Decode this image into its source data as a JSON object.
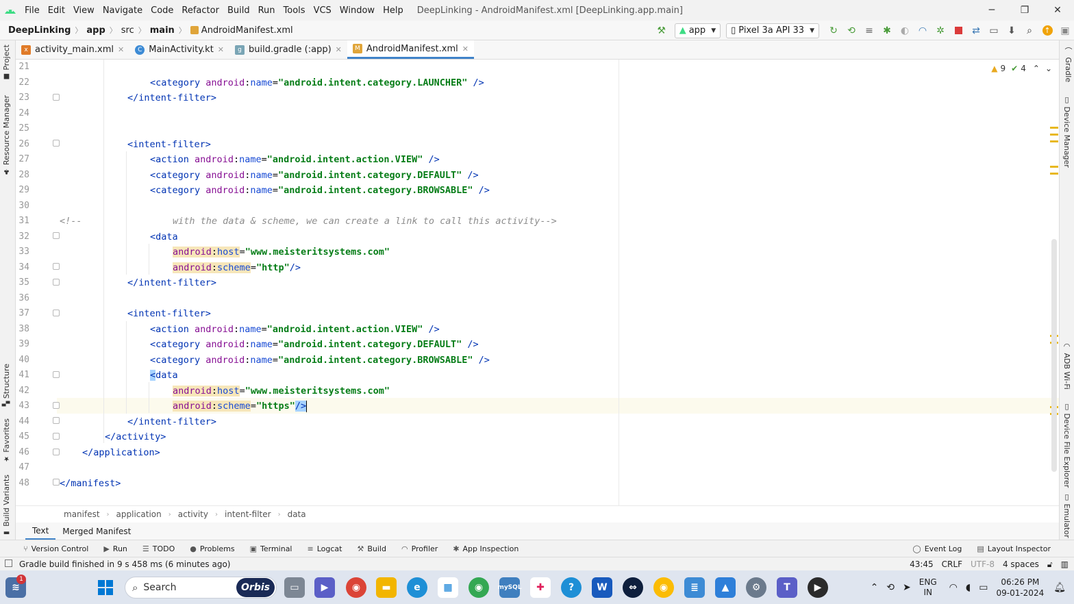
{
  "menubar": {
    "items": [
      "File",
      "Edit",
      "View",
      "Navigate",
      "Code",
      "Refactor",
      "Build",
      "Run",
      "Tools",
      "VCS",
      "Window",
      "Help"
    ],
    "window_title": "DeepLinking - AndroidManifest.xml [DeepLinking.app.main]",
    "minimize": "─",
    "maximize": "❐",
    "close": "✕"
  },
  "navbar": {
    "crumbs": [
      "DeepLinking",
      "app",
      "src",
      "main",
      "AndroidManifest.xml"
    ],
    "run_config": "app",
    "device": "Pixel 3a API 33"
  },
  "tabs": [
    {
      "label": "activity_main.xml",
      "icon": "xml-file-icon",
      "color": "#e07b28"
    },
    {
      "label": "MainActivity.kt",
      "icon": "kotlin-class-icon",
      "color": "#3d8bd5"
    },
    {
      "label": "build.gradle (:app)",
      "icon": "gradle-icon",
      "color": "#7aa5b5"
    },
    {
      "label": "AndroidManifest.xml",
      "icon": "manifest-icon",
      "color": "#e0a53a"
    }
  ],
  "left_tools": [
    "Project",
    "Resource Manager",
    "Structure",
    "Favorites",
    "Build Variants"
  ],
  "right_tools": [
    "Gradle",
    "Device Manager",
    "ADB Wi-Fi",
    "Device File Explorer",
    "Emulator"
  ],
  "inspection": {
    "warnings": "9",
    "weak_warnings": "4"
  },
  "lines": [
    "21",
    "22",
    "23",
    "24",
    "25",
    "26",
    "27",
    "28",
    "29",
    "30",
    "31",
    "32",
    "33",
    "34",
    "35",
    "36",
    "37",
    "38",
    "39",
    "40",
    "41",
    "42",
    "43",
    "44",
    "45",
    "46",
    "47",
    "48"
  ],
  "code": {
    "l22": {
      "tag": "<category",
      "ns": "android",
      "attr": "name",
      "val": "\"android.intent.category.LAUNCHER\"",
      "end": " />"
    },
    "l23": "</intent-filter>",
    "l26": "<intent-filter>",
    "l27": {
      "tag": "<action",
      "ns": "android",
      "attr": "name",
      "val": "\"android.intent.action.VIEW\"",
      "end": " />"
    },
    "l28": {
      "tag": "<category",
      "ns": "android",
      "attr": "name",
      "val": "\"android.intent.category.DEFAULT\"",
      "end": " />"
    },
    "l29": {
      "tag": "<category",
      "ns": "android",
      "attr": "name",
      "val": "\"android.intent.category.BROWSABLE\"",
      "end": " />"
    },
    "l31_open": "<!--",
    "l31_text": "with the data & scheme, we can create a link to call this activity-->",
    "l32": "<data",
    "l33": {
      "ns": "android",
      "attr": "host",
      "val": "\"www.meisteritsystems.com\""
    },
    "l34": {
      "ns": "android",
      "attr": "scheme",
      "val": "\"http\"",
      "end": "/>"
    },
    "l35": "</intent-filter>",
    "l37": "<intent-filter>",
    "l38": {
      "tag": "<action",
      "ns": "android",
      "attr": "name",
      "val": "\"android.intent.action.VIEW\"",
      "end": " />"
    },
    "l39": {
      "tag": "<category",
      "ns": "android",
      "attr": "name",
      "val": "\"android.intent.category.DEFAULT\"",
      "end": " />"
    },
    "l40": {
      "tag": "<category",
      "ns": "android",
      "attr": "name",
      "val": "\"android.intent.category.BROWSABLE\"",
      "end": " />"
    },
    "l41_lt": "<",
    "l41_rest": "data",
    "l42": {
      "ns": "android",
      "attr": "host",
      "val": "\"www.meisteritsystems.com\""
    },
    "l43": {
      "ns": "android",
      "attr": "scheme",
      "val": "\"https\"",
      "end": "/>"
    },
    "l44": "</intent-filter>",
    "l45": "</activity>",
    "l46": "</application>",
    "l48": "</manifest>"
  },
  "xml_breadcrumb": [
    "manifest",
    "application",
    "activity",
    "intent-filter",
    "data"
  ],
  "editor_tabs": [
    "Text",
    "Merged Manifest"
  ],
  "bottom_tools": [
    "Version Control",
    "Run",
    "TODO",
    "Problems",
    "Terminal",
    "Logcat",
    "Build",
    "Profiler",
    "App Inspection"
  ],
  "bottom_tools_right": [
    "Event Log",
    "Layout Inspector"
  ],
  "status": {
    "message": "Gradle build finished in 9 s 458 ms (6 minutes ago)",
    "position": "43:45",
    "line_sep": "CRLF",
    "encoding": "UTF-8",
    "indent": "4 spaces"
  },
  "taskbar": {
    "search_placeholder": "Search",
    "search_brand": "Orbis",
    "lang_line1": "ENG",
    "lang_line2": "IN",
    "time": "06:26 PM",
    "date": "09-01-2024",
    "notif_count": "1"
  }
}
